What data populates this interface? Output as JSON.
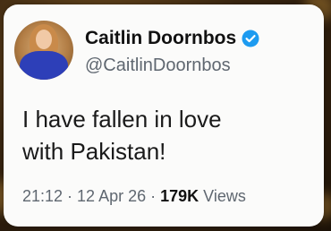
{
  "tweet": {
    "author": {
      "display_name": "Caitlin Doornbos",
      "handle": "@CaitlinDoornbos",
      "verified": true,
      "verified_color": "#1d9bf0"
    },
    "text_line1": "I have fallen in love",
    "text_line2": "with Pakistan!",
    "time": "21:12",
    "separator": " · ",
    "date": "12 Apr 26",
    "views_count": "179K",
    "views_label": "Views"
  }
}
